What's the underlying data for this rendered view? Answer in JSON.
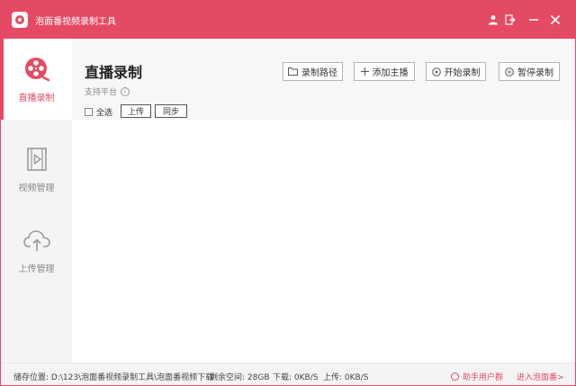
{
  "titlebar": {
    "title": "泡面番视频录制工具"
  },
  "sidebar": {
    "items": [
      {
        "label": "直播录制",
        "icon": "film-reel-icon",
        "active": true
      },
      {
        "label": "视频管理",
        "icon": "video-file-icon",
        "active": false
      },
      {
        "label": "上传管理",
        "icon": "cloud-upload-icon",
        "active": false
      }
    ]
  },
  "header": {
    "title": "直播录制",
    "platform_label": "支持平台",
    "buttons": {
      "path": "录制路径",
      "add": "添加主播",
      "start": "开始录制",
      "pause": "暂停录制"
    },
    "select_all": "全选",
    "upload": "上传",
    "sync": "同步"
  },
  "status": {
    "path": "储存位置: D:\\123\\泡面番视频录制工具\\泡面番视频下载",
    "space": "剩余空间: 28GB",
    "download": "下载: 0KB/S",
    "upload": "上传: 0KB/S",
    "group": "助手用户群",
    "enter": "进入泡面番>"
  },
  "colors": {
    "accent": "#e54a64"
  }
}
